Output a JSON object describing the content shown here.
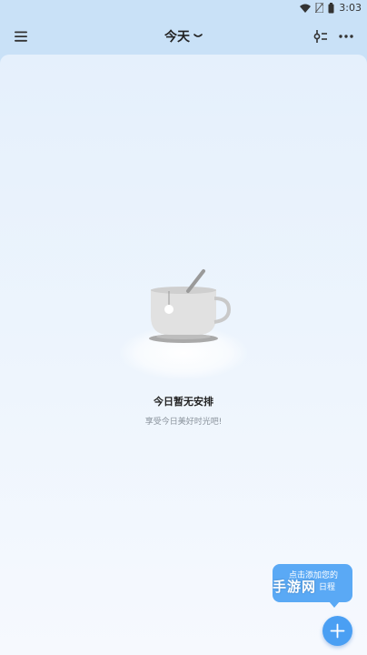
{
  "status_bar": {
    "time": "3:03",
    "icons": [
      "wifi-icon",
      "no-sim-icon",
      "battery-icon"
    ]
  },
  "header": {
    "title": "今天",
    "left_icon": "menu-icon",
    "title_icon": "chevron-down-icon",
    "right_icons": [
      "filter-icon",
      "more-icon"
    ]
  },
  "empty_state": {
    "illustration": "coffee-cup-icon",
    "title": "今日暂无安排",
    "subtitle": "享受今日美好时光吧!"
  },
  "tooltip": {
    "line1": "点击添加您的",
    "line2": "日程"
  },
  "watermark": "手游网",
  "fab": {
    "icon": "plus-icon"
  },
  "colors": {
    "header_bg": "#c9e1f7",
    "content_bg": "#e5f0fc",
    "accent": "#4a9ff3",
    "tooltip_bg": "#5aa9f5"
  }
}
